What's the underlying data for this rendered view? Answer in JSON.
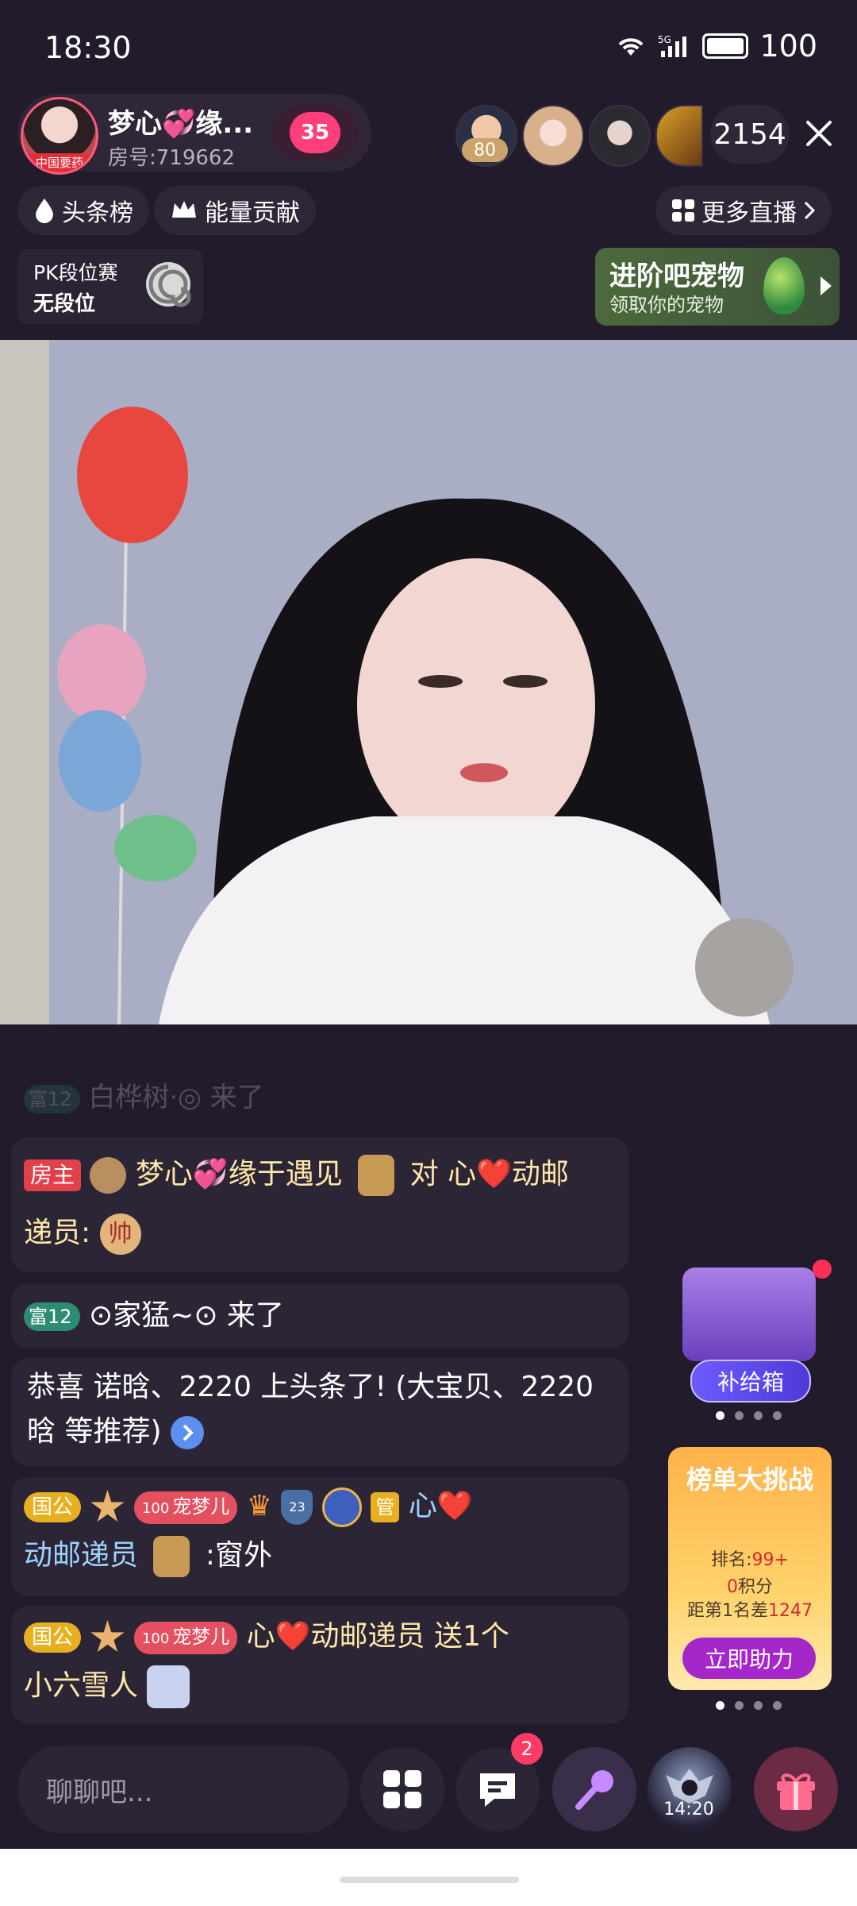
{
  "status": {
    "time": "18:30",
    "battery": "100",
    "network": "5G"
  },
  "host": {
    "name": "梦心💞缘...",
    "room": "房号:719662",
    "avatar_tag": "中国要药",
    "follow_level": "35"
  },
  "viewers": {
    "count": "2154",
    "top_viewer_level": "80"
  },
  "chips": {
    "headline": "头条榜",
    "energy": "能量贡献",
    "more": "更多直播"
  },
  "pk": {
    "title": "PK段位赛",
    "rank": "无段位"
  },
  "pet": {
    "title": "进阶吧宠物",
    "subtitle": "领取你的宠物"
  },
  "chat": {
    "faded": {
      "badge": "富12",
      "text": "白桦树·◎ 来了"
    },
    "m1": {
      "badge": "房主",
      "name": "梦心💞缘于遇见",
      "mid": "对 心❤️动邮",
      "line2": "递员:",
      "seal": "帅"
    },
    "m2": {
      "badge": "富12",
      "text": "⊙家猛~⊙ 来了"
    },
    "m3": {
      "line1": "恭喜 诺晗、2220 上头条了! (大宝贝、2220",
      "line2": "晗 等推荐)"
    },
    "m4": {
      "badge": "国公",
      "level_num": "100",
      "fan": "宠梦儿",
      "shield_num": "23",
      "guan": "管",
      "tail": "心❤️",
      "name": "动邮递员",
      "text": ":窗外"
    },
    "m5": {
      "badge": "国公",
      "level_num": "100",
      "fan": "宠梦儿",
      "text": "心❤️动邮递员 送1个",
      "line2": "小六雪人"
    }
  },
  "supply": {
    "label": "补给箱"
  },
  "rank_card": {
    "title": "榜单大挑战",
    "rank_label": "排名:",
    "rank_value": "99+",
    "points_value": "0",
    "points_label": "积分",
    "gap_label": "距第1名差",
    "gap_value": "1247",
    "button": "立即助力"
  },
  "bottom": {
    "chat_placeholder": "聊聊吧...",
    "msg_badge": "2",
    "game_time": "14:20"
  },
  "colors": {
    "background": "#221b2c",
    "accent_pink": "#ff3e7a",
    "rank_button": "#a526c9"
  }
}
